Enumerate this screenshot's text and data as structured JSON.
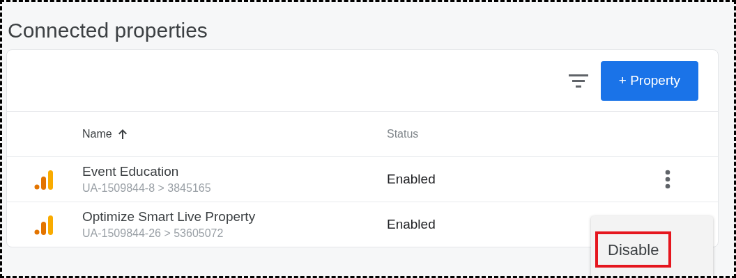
{
  "page": {
    "title": "Connected properties"
  },
  "toolbar": {
    "add_button": "+ Property"
  },
  "table": {
    "columns": [
      {
        "label": "Name",
        "sorted": true
      },
      {
        "label": "Status",
        "sorted": false
      }
    ],
    "rows": [
      {
        "name": "Event Education",
        "id": "UA-1509844-8 > 3845165",
        "status": "Enabled"
      },
      {
        "name": "Optimize Smart Live Property",
        "id": "UA-1509844-26 > 53605072",
        "status": "Enabled"
      }
    ]
  },
  "context_menu": {
    "items": [
      {
        "label": "Disable",
        "highlighted": true
      }
    ]
  }
}
